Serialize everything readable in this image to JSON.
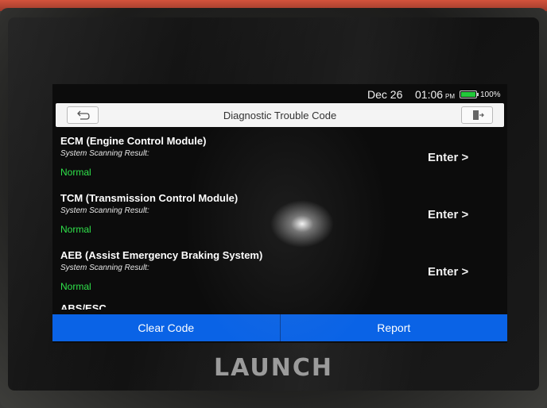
{
  "status_bar": {
    "date": "Dec 26",
    "time": "01:06",
    "ampm": "PM",
    "battery_percent": "100%",
    "battery_level": 1.0,
    "battery_color": "#22c93a"
  },
  "header": {
    "title": "Diagnostic Trouble Code",
    "back_icon": "back-arrow-icon",
    "exit_icon": "exit-icon"
  },
  "systems": [
    {
      "name": "ECM (Engine Control Module)",
      "result_label": "System Scanning Result:",
      "status": "Normal",
      "action": "Enter >"
    },
    {
      "name": "TCM (Transmission Control Module)",
      "result_label": "System Scanning Result:",
      "status": "Normal",
      "action": "Enter >"
    },
    {
      "name": "AEB (Assist Emergency Braking System)",
      "result_label": "System Scanning Result:",
      "status": "Normal",
      "action": "Enter >"
    }
  ],
  "partial_item": "ABS/ESC",
  "footer": {
    "clear_code": "Clear Code",
    "report": "Report",
    "accent_color": "#0a63e6"
  },
  "status_color": "#2fe24a",
  "device_brand": "LAUNCH"
}
